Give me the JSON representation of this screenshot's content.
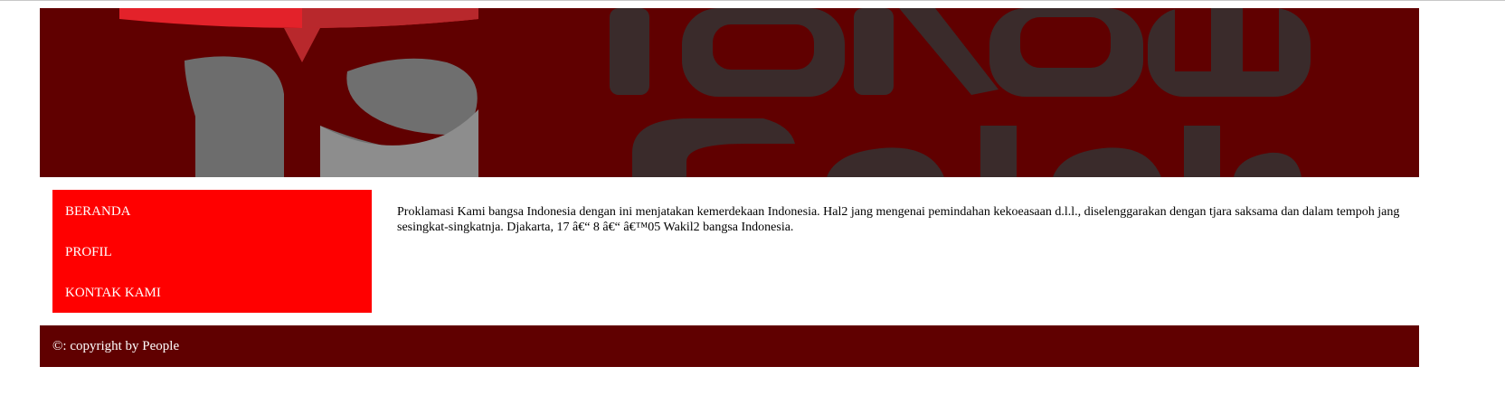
{
  "banner": {
    "logo_text": "Telkom Schools",
    "background_color": "#600000"
  },
  "nav": {
    "items": [
      {
        "label": "BERANDA"
      },
      {
        "label": "PROFIL"
      },
      {
        "label": "KONTAK KAMI"
      }
    ],
    "background_color": "#ff0000"
  },
  "main": {
    "text": "Proklamasi Kami bangsa Indonesia dengan ini menjatakan kemerdekaan Indonesia. Hal2 jang mengenai pemindahan kekoeasaan d.l.l., diselenggarakan dengan tjara saksama dan dalam tempoh jang sesingkat-singkatnja. Djakarta, 17 â€“ 8 â€“ â€™05 Wakil2 bangsa Indonesia."
  },
  "footer": {
    "text": "©: copyright by People"
  }
}
